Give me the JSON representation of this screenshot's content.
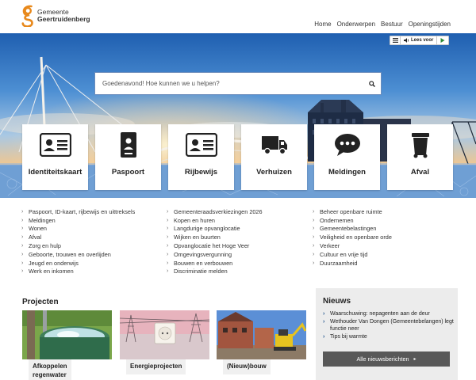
{
  "header": {
    "logo_line1": "Gemeente",
    "logo_line2": "Geertruidenberg",
    "nav": [
      "Home",
      "Onderwerpen",
      "Bestuur",
      "Openingstijden"
    ]
  },
  "readspeaker": {
    "label": "Lees voor"
  },
  "search": {
    "placeholder": "Goedenavond! Hoe kunnen we u helpen?"
  },
  "tiles": [
    {
      "label": "Identiteitskaart",
      "icon": "id-card-icon"
    },
    {
      "label": "Paspoort",
      "icon": "passport-icon"
    },
    {
      "label": "Rijbewijs",
      "icon": "drivers-license-icon"
    },
    {
      "label": "Verhuizen",
      "icon": "moving-truck-icon"
    },
    {
      "label": "Meldingen",
      "icon": "speech-bubble-icon"
    },
    {
      "label": "Afval",
      "icon": "waste-bin-icon"
    }
  ],
  "links": {
    "col1": [
      "Paspoort, ID-kaart, rijbewijs en uittreksels",
      "Meldingen",
      "Wonen",
      "Afval",
      "Zorg en hulp",
      "Geboorte, trouwen en overlijden",
      "Jeugd en onderwijs",
      "Werk en inkomen"
    ],
    "col2": [
      "Gemeenteraadsverkiezingen 2026",
      "Kopen en huren",
      "Langdurige opvanglocatie",
      "Wijken en buurten",
      "Opvanglocatie het Hoge Veer",
      "Omgevingsvergunning",
      "Bouwen en verbouwen",
      "Discriminatie melden"
    ],
    "col3": [
      "Beheer openbare ruimte",
      "Ondernemen",
      "Gemeentebelastingen",
      "Veiligheid en openbare orde",
      "Verkeer",
      "Cultuur en vrije tijd",
      "Duurzaamheid"
    ]
  },
  "projects": {
    "title": "Projecten",
    "cards": [
      {
        "label_line1": "Afkoppelen",
        "label_line2": "regenwater"
      },
      {
        "label_line1": "Energieprojecten",
        "label_line2": ""
      },
      {
        "label_line1": "(Nieuw)bouw",
        "label_line2": ""
      }
    ]
  },
  "news": {
    "title": "Nieuws",
    "items": [
      "Waarschuwing: nepagenten aan de deur",
      "Wethouder Van Dongen (Gemeentebelangen) legt functie neer",
      "Tips bij warmte"
    ],
    "all_label": "Alle nieuwsberichten"
  },
  "colors": {
    "brand_orange": "#e8891c",
    "tile_text": "#222222",
    "news_button": "#585858"
  }
}
